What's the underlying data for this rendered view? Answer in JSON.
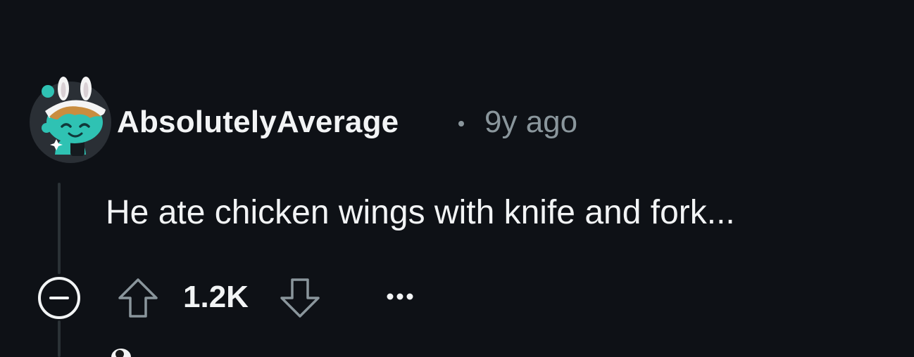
{
  "comment": {
    "author": "AbsolutelyAverage",
    "timestamp": "9y ago",
    "body": "He ate chicken wings with knife and fork...",
    "score": "1.2K"
  },
  "icons": {
    "collapse": "collapse-minus-icon",
    "upvote": "upvote-arrow-icon",
    "downvote": "downvote-arrow-icon",
    "more": "more-options-icon",
    "avatar": "snoo-avatar-icon"
  },
  "colors": {
    "background": "#0e1116",
    "text_primary": "#f2f4f5",
    "text_secondary": "#8a969c",
    "thread_line": "#2b3236",
    "avatar_teal": "#2fc2b3"
  }
}
